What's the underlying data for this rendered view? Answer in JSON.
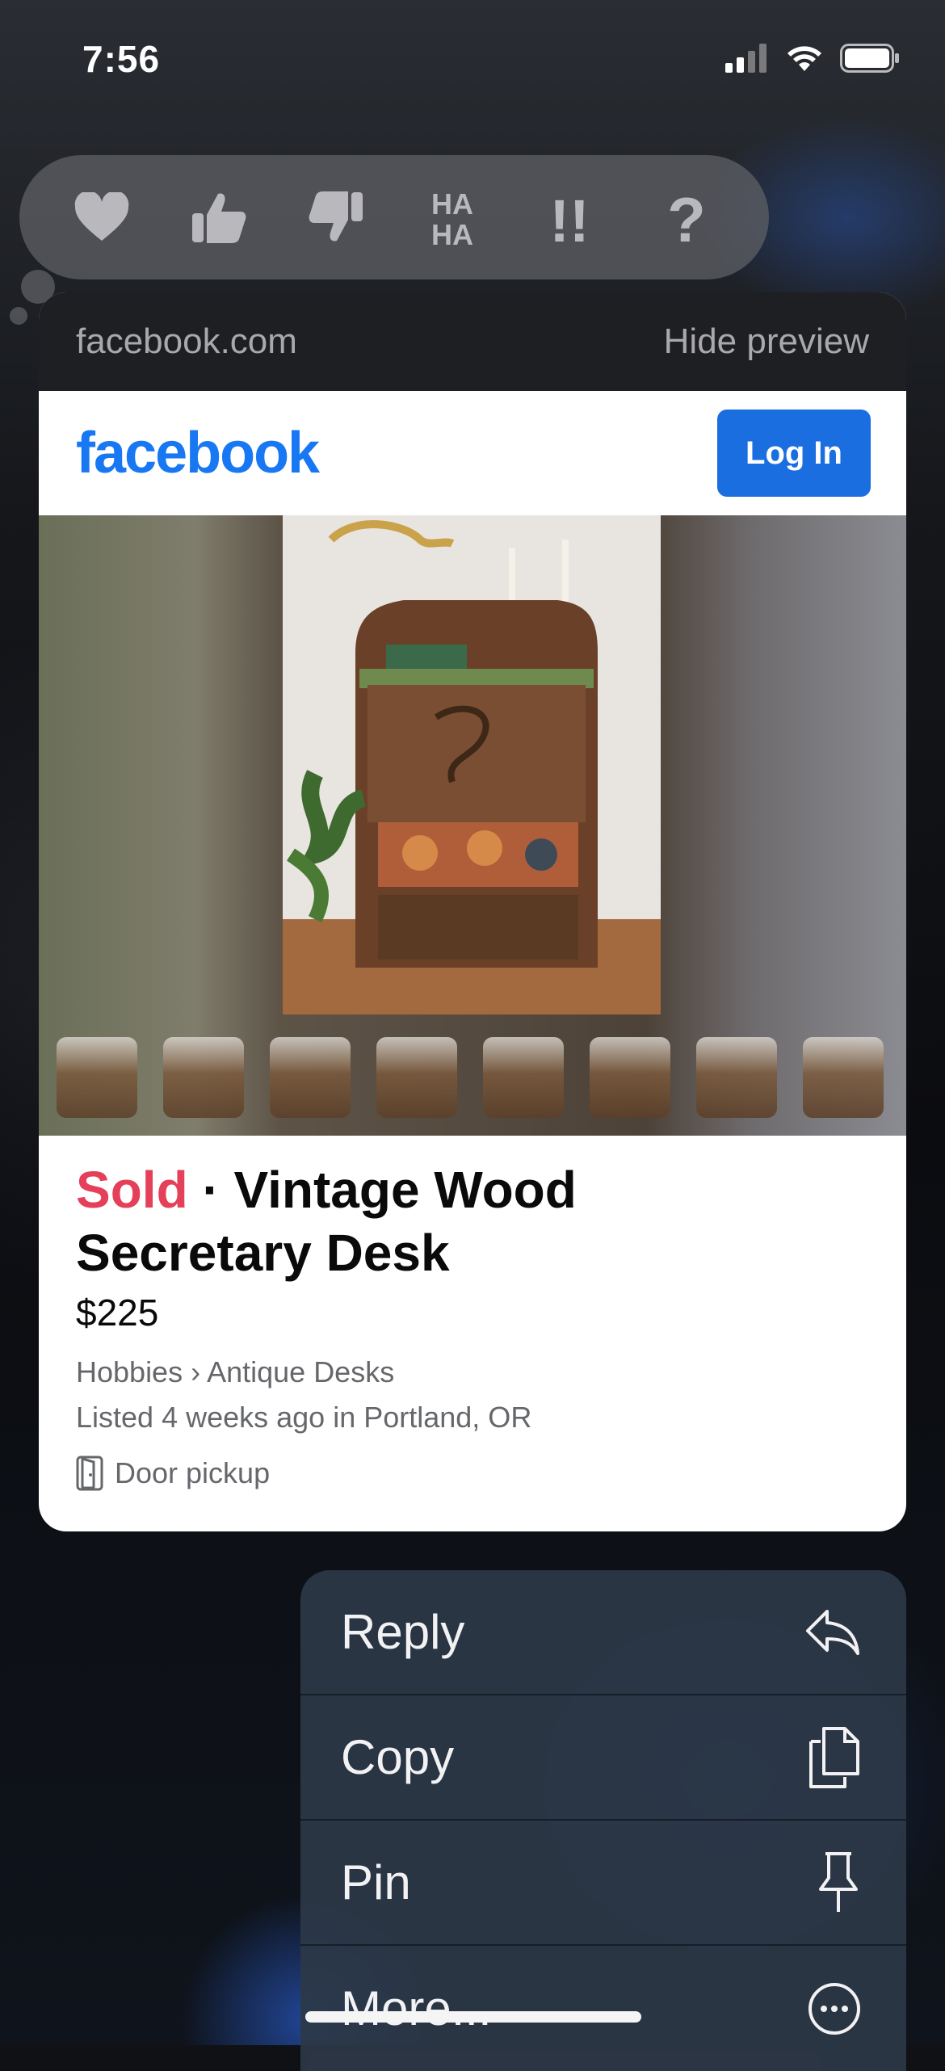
{
  "status_bar": {
    "time": "7:56"
  },
  "reactions": [
    {
      "name": "heart",
      "label": ""
    },
    {
      "name": "thumbs-up",
      "label": ""
    },
    {
      "name": "thumbs-down",
      "label": ""
    },
    {
      "name": "haha",
      "label": "HA\nHA"
    },
    {
      "name": "emphasize",
      "label": "!!"
    },
    {
      "name": "question",
      "label": "?"
    }
  ],
  "preview": {
    "domain": "facebook.com",
    "hide_label": "Hide preview",
    "logo": "facebook",
    "login_label": "Log In",
    "listing": {
      "status": "Sold",
      "separator": " · ",
      "title": "Vintage Wood Secretary Desk",
      "price": "$225",
      "category": "Hobbies › Antique Desks",
      "listed": "Listed 4 weeks ago in Portland, OR",
      "delivery": "Door pickup"
    },
    "thumbnail_count": 8
  },
  "menu": {
    "reply": "Reply",
    "copy": "Copy",
    "pin": "Pin",
    "more": "More..."
  },
  "colors": {
    "facebook_blue": "#1877f2",
    "login_button": "#1a6ee0",
    "sold_red": "#e4405a"
  }
}
